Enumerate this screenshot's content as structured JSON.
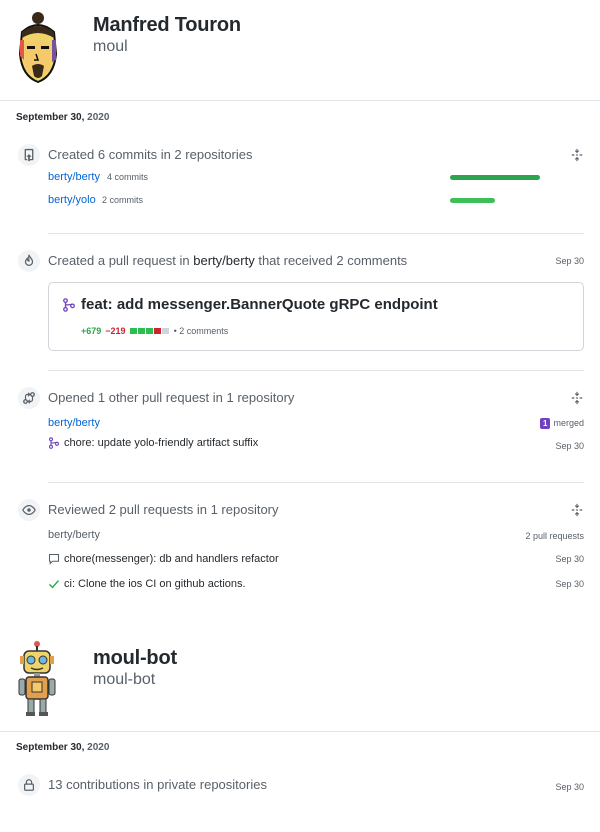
{
  "profiles": [
    {
      "name": "Manfred Touron",
      "login": "moul",
      "date_day": "September 30,",
      "date_year": "2020",
      "events": {
        "commits": {
          "title": "Created 6 commits in 2 repositories",
          "repos": [
            {
              "name": "berty/berty",
              "count": "4 commits",
              "share": 1.0
            },
            {
              "name": "berty/yolo",
              "count": "2 commits",
              "share": 0.5
            }
          ]
        },
        "pull_request": {
          "title_prefix": "Created a pull request in",
          "repo": "berty/berty",
          "title_suffix": "that received 2 comments",
          "date": "Sep 30",
          "pr_title": "feat: add messenger.BannerQuote gRPC endpoint",
          "additions": "+679",
          "deletions": "−219",
          "comments": "• 2 comments"
        },
        "opened": {
          "title": "Opened 1 other pull request in 1 repository",
          "repo": "berty/berty",
          "badge_count": "1",
          "badge_label": "merged",
          "item": "chore: update yolo-friendly artifact suffix",
          "item_date": "Sep 30"
        },
        "reviewed": {
          "title": "Reviewed 2 pull requests in 1 repository",
          "repo": "berty/berty",
          "count": "2 pull requests",
          "items": [
            {
              "label": "chore(messenger): db and handlers refactor",
              "date": "Sep 30",
              "icon": "comment-icon"
            },
            {
              "label": "ci: Clone the ios CI on github actions.",
              "date": "Sep 30",
              "icon": "check-icon"
            }
          ]
        }
      }
    },
    {
      "name": "moul-bot",
      "login": "moul-bot",
      "date_day": "September 30,",
      "date_year": "2020",
      "events": {
        "private": {
          "title": "13 contributions in private repositories",
          "date": "Sep 30"
        }
      }
    }
  ],
  "colors": {
    "link": "#0366d6",
    "bar": "#2ea44f",
    "additions": "#28a745",
    "deletions": "#cb2431",
    "merged": "#6f42c1"
  }
}
